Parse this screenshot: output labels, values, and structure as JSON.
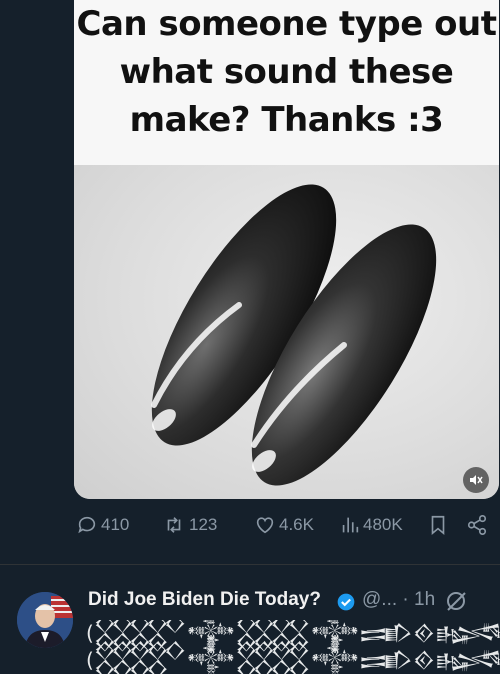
{
  "post": {
    "caption_lines": [
      "Can someone type out",
      "what sound these",
      "make? Thanks :3"
    ],
    "image_subject": "two black hematite magnet eggs",
    "mute_icon": "muted-speaker-icon"
  },
  "actions": {
    "replies": "410",
    "reposts": "123",
    "likes": "4.6K",
    "views": "480K"
  },
  "reply": {
    "display_name": "Did Joe Biden Die Today?",
    "handle": "@...",
    "time": "· 1h",
    "text_line1": "(𒐫𒀱𒐪𒀱𒅃𒐬𒈙𒌄𒋙 𒄿𒌋𒐫𒀱𒅃",
    "text_line2": "(𒐫𒀱𒐪𒀱𒅃𒐬𒈙𒌄𒋙𒐫𒀱𒅃"
  },
  "colors": {
    "background": "#15202b",
    "muted_text": "#8b98a5",
    "verified": "#1d9bf0"
  }
}
